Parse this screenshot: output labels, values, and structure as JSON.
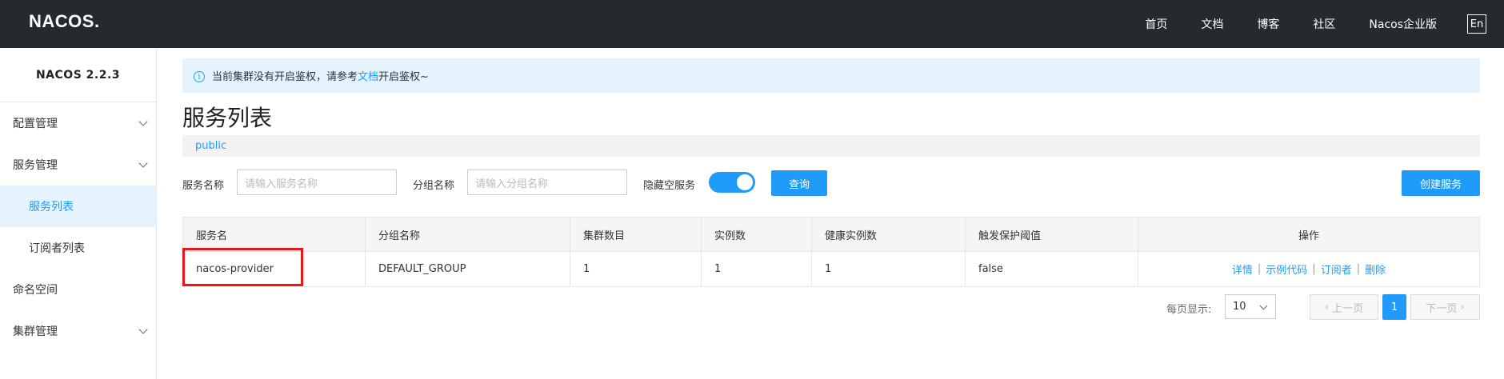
{
  "header": {
    "logo": "NACOS.",
    "nav": [
      "首页",
      "文档",
      "博客",
      "社区",
      "Nacos企业版"
    ],
    "lang_label": "En"
  },
  "sidebar": {
    "version": "NACOS 2.2.3",
    "items": [
      {
        "label": "配置管理",
        "expandable": true
      },
      {
        "label": "服务管理",
        "expandable": true
      },
      {
        "label": "服务列表",
        "active": true
      },
      {
        "label": "订阅者列表"
      },
      {
        "label": "命名空间"
      },
      {
        "label": "集群管理",
        "expandable": true
      }
    ]
  },
  "notice": {
    "prefix": "当前集群没有开启鉴权，请参考",
    "link": "文档",
    "suffix": "开启鉴权~"
  },
  "page": {
    "title": "服务列表",
    "namespace": "public"
  },
  "filter": {
    "service_name_label": "服务名称",
    "service_name_placeholder": "请输入服务名称",
    "group_name_label": "分组名称",
    "group_name_placeholder": "请输入分组名称",
    "hide_empty_label": "隐藏空服务",
    "hide_empty_on": true,
    "query_label": "查询",
    "create_label": "创建服务"
  },
  "table": {
    "columns": [
      "服务名",
      "分组名称",
      "集群数目",
      "实例数",
      "健康实例数",
      "触发保护阈值",
      "操作"
    ],
    "rows": [
      {
        "service": "nacos-provider",
        "group": "DEFAULT_GROUP",
        "clusters": "1",
        "instances": "1",
        "healthy": "1",
        "threshold": "false",
        "actions": [
          "详情",
          "示例代码",
          "订阅者",
          "删除"
        ]
      }
    ]
  },
  "pagination": {
    "page_size_label": "每页显示:",
    "page_size": "10",
    "prev_label": "上一页",
    "current_page": "1",
    "next_label": "下一页"
  },
  "colors": {
    "primary": "#209bfa",
    "header_bg": "#252a2f",
    "highlight_border": "#e8161b"
  }
}
